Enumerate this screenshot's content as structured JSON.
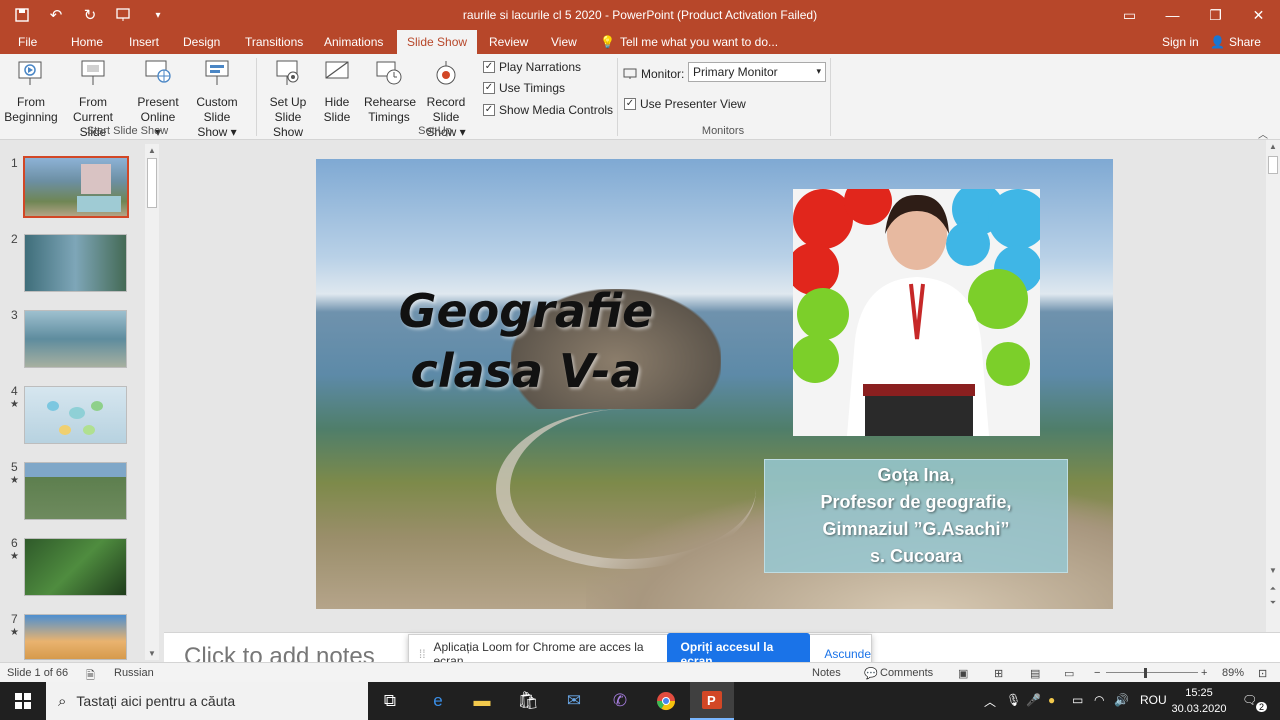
{
  "window": {
    "title": "raurile si lacurile cl 5 2020  -  PowerPoint (Product Activation Failed)"
  },
  "tabs": [
    {
      "label": "File"
    },
    {
      "label": "Home"
    },
    {
      "label": "Insert"
    },
    {
      "label": "Design"
    },
    {
      "label": "Transitions"
    },
    {
      "label": "Animations"
    },
    {
      "label": "Slide Show"
    },
    {
      "label": "Review"
    },
    {
      "label": "View"
    }
  ],
  "tell_me": "Tell me what you want to do...",
  "sign_in": "Sign in",
  "share": "Share",
  "ribbon": {
    "from_beginning": [
      "From",
      "Beginning"
    ],
    "from_current": [
      "From",
      "Current Slide"
    ],
    "present_online": [
      "Present",
      "Online ▾"
    ],
    "custom_show": [
      "Custom Slide",
      "Show ▾"
    ],
    "group_start": "Start Slide Show",
    "setup_show": [
      "Set Up",
      "Slide Show"
    ],
    "hide_slide": [
      "Hide",
      "Slide"
    ],
    "rehearse": [
      "Rehearse",
      "Timings"
    ],
    "record": [
      "Record Slide",
      "Show ▾"
    ],
    "play_narrations": "Play Narrations",
    "use_timings": "Use Timings",
    "show_media": "Show Media Controls",
    "group_setup": "Set Up",
    "monitor_label": "Monitor:",
    "monitor_value": "Primary Monitor",
    "presenter_view": "Use Presenter View",
    "group_monitors": "Monitors"
  },
  "thumbnails": [
    {
      "num": "1",
      "star": ""
    },
    {
      "num": "2",
      "star": ""
    },
    {
      "num": "3",
      "star": ""
    },
    {
      "num": "4",
      "star": "★"
    },
    {
      "num": "5",
      "star": "★"
    },
    {
      "num": "6",
      "star": "★"
    },
    {
      "num": "7",
      "star": "★"
    }
  ],
  "slide": {
    "heading_line1": "Geografie",
    "heading_line2": "clasa V-a",
    "caption": [
      "Goța Ina,",
      "Profesor de geografie,",
      "Gimnaziul ”G.Asachi”",
      "s. Cucoara"
    ]
  },
  "notes_placeholder": "Click to add notes",
  "loom": {
    "message": "Aplicația Loom for Chrome are acces la ecran.",
    "stop": "Opriți accesul la ecran",
    "hide": "Ascunde"
  },
  "status": {
    "slide_of": "Slide 1 of 66",
    "language": "Russian",
    "notes": "Notes",
    "comments": "Comments",
    "zoom": "89%"
  },
  "taskbar": {
    "search_placeholder": "Tastați aici pentru a căuta",
    "lang": "ROU",
    "time": "15:25",
    "date": "30.03.2020",
    "notifications": "2"
  },
  "colors": {
    "accent": "#b7472a",
    "selected_thumb": "#d24726",
    "loom_button": "#1a73e8"
  }
}
